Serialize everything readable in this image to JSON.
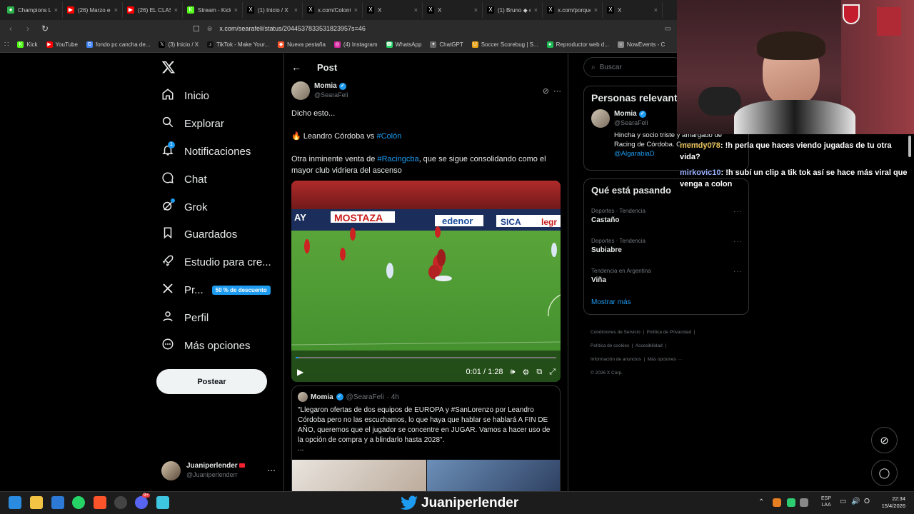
{
  "browser": {
    "tabs": [
      {
        "label": "Champions Leag",
        "icon": "champions-icon",
        "color": "#2bb24c"
      },
      {
        "label": "(26) Marzo en Tw",
        "icon": "youtube-icon",
        "color": "#ff0000"
      },
      {
        "label": "(26) EL CLASICO",
        "icon": "youtube-icon",
        "color": "#ff0000"
      },
      {
        "label": "Stream - Kick Da",
        "icon": "kick-icon",
        "color": "#53fc18"
      },
      {
        "label": "(1) Inicio / X",
        "icon": "x-icon",
        "color": "#000000"
      },
      {
        "label": "x.com/ColonOfic",
        "icon": "x-icon",
        "color": "#000000"
      },
      {
        "label": "X",
        "icon": "x-icon",
        "color": "#000000"
      },
      {
        "label": "X",
        "icon": "x-icon",
        "color": "#000000"
      },
      {
        "label": "(1) Bruno ◆ en X",
        "icon": "x-icon",
        "color": "#000000"
      },
      {
        "label": "x.com/porquetta",
        "icon": "x-icon",
        "color": "#000000"
      },
      {
        "label": "X",
        "icon": "x-icon",
        "color": "#000000"
      }
    ],
    "url": "x.com/searafeli/status/2044537833531823957s=46",
    "bookmarks": [
      {
        "label": "Kick",
        "color": "#53fc18",
        "glyph": "K"
      },
      {
        "label": "YouTube",
        "color": "#ff0000",
        "glyph": "▶"
      },
      {
        "label": "fondo pc cancha de...",
        "color": "#4285f4",
        "glyph": "G"
      },
      {
        "label": "(3) Inicio / X",
        "color": "#000000",
        "glyph": "𝕏"
      },
      {
        "label": "TikTok - Make Your...",
        "color": "#111111",
        "glyph": "♪"
      },
      {
        "label": "Nueva pestaña",
        "color": "#fb542b",
        "glyph": "◆"
      },
      {
        "label": "(4) Instagram",
        "color": "#d6249f",
        "glyph": "◎"
      },
      {
        "label": "WhatsApp",
        "color": "#25d366",
        "glyph": "☎"
      },
      {
        "label": "ChatGPT",
        "color": "#666666",
        "glyph": "✦"
      },
      {
        "label": "Soccer Scorebug | S...",
        "color": "#e8a317",
        "glyph": "U"
      },
      {
        "label": "Reproductor web d...",
        "color": "#1db954",
        "glyph": "●"
      },
      {
        "label": "NowEvents - C",
        "color": "#888888",
        "glyph": "○"
      }
    ]
  },
  "nav": {
    "items": [
      {
        "label": "Inicio",
        "icon": "home-icon"
      },
      {
        "label": "Explorar",
        "icon": "search-icon"
      },
      {
        "label": "Notificaciones",
        "icon": "bell-icon",
        "badge": "1"
      },
      {
        "label": "Chat",
        "icon": "chat-icon"
      },
      {
        "label": "Grok",
        "icon": "grok-icon"
      },
      {
        "label": "Guardados",
        "icon": "bookmark-icon"
      },
      {
        "label": "Estudio para cre...",
        "icon": "rocket-icon"
      },
      {
        "label": "Pr...",
        "icon": "x-premium-icon",
        "promo": "50 % de descuento"
      },
      {
        "label": "Perfil",
        "icon": "person-icon"
      },
      {
        "label": "Más opciones",
        "icon": "more-circle-icon"
      }
    ],
    "post_button": "Postear",
    "account": {
      "name": "Juaniperlender",
      "handle": "@Juaniperlenderr"
    }
  },
  "post": {
    "header_title": "Post",
    "author": {
      "name": "Momia",
      "handle": "@SearaFeli"
    },
    "line1": "Dicho esto...",
    "line2_prefix": "🔥 Leandro Córdoba vs ",
    "line2_tag": "#Colón",
    "line3_prefix": "Otra inminente venta de ",
    "line3_tag": "#Racingcba",
    "line3_suffix": ", que se sigue consolidando como el mayor club vidriera del ascenso",
    "video": {
      "time": "0:01 / 1:28",
      "progress": 0.01,
      "ads": [
        "MOSTAZA",
        "edenor",
        "SICA",
        "legr",
        "AY"
      ]
    },
    "quote": {
      "name": "Momia",
      "handle": "@SearaFeli",
      "time": "· 4h",
      "text": "\"Llegaron ofertas de dos equipos de EUROPA y #SanLorenzo por Leandro Córdoba pero no las escuchamos, lo que haya que hablar se hablará A FIN DE AÑO, queremos que el jugador se concentre en JUGAR. Vamos a hacer uso de la opción de compra y a blindarlo hasta 2028\".",
      "ellipsis": "..."
    }
  },
  "right": {
    "search_placeholder": "Buscar",
    "relevant_title": "Personas relevantes",
    "relevant_person": {
      "name": "Momia",
      "handle": "@SearaFeli",
      "bio": "Hincha y socio triste y amargado de Racing de Córdoba. Cuervo para",
      "bio_link": "@AlgarabiaD"
    },
    "trends_title": "Qué está pasando",
    "trends": [
      {
        "category": "Deportes · Tendencia",
        "name": "Castaño"
      },
      {
        "category": "Deportes · Tendencia",
        "name": "Subiabre"
      },
      {
        "category": "Tendencia en Argentina",
        "name": "Viña"
      }
    ],
    "show_more": "Mostrar más",
    "footer": [
      "Condiciones de Servicio",
      "Política de Privacidad",
      "Política de cookies",
      "Accesibilidad",
      "Información de anuncios",
      "Más opciones ···",
      "© 2026 X Corp."
    ]
  },
  "chat_overlay": [
    {
      "user": "memdy078",
      "user_color": "#e8c25a",
      "text": ": !h perla que haces viendo jugadas de tu otra vida?"
    },
    {
      "user": "mirkovic10",
      "user_color": "#9ab0ff",
      "text": ": !h subí un clip a tik tok así se hace más viral que venga a colon"
    }
  ],
  "taskbar": {
    "channel_name": "Juaniperlender",
    "lang": "ESP",
    "lang2": "LAA",
    "time": "22:34",
    "date": "15/4/2026",
    "discord_badge": "9+"
  }
}
